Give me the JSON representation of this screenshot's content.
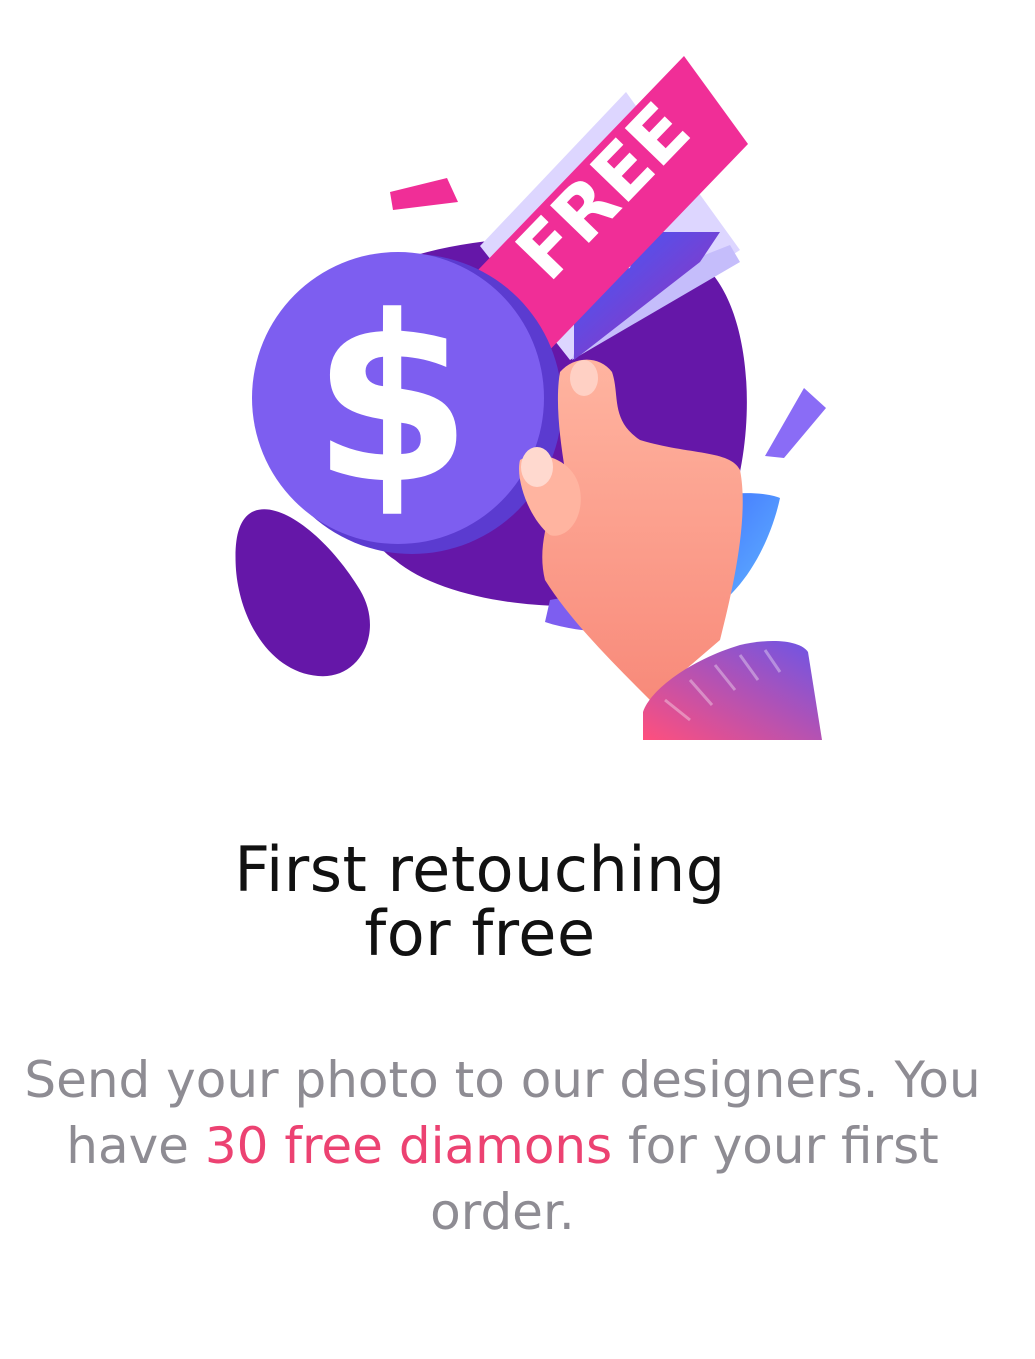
{
  "illustration": {
    "badge_text": "FREE",
    "coin_symbol": "$",
    "colors": {
      "blob": "#6517a8",
      "coin": "#7d5ef0",
      "coin_light": "#8a6cf6",
      "badge": "#f02e97",
      "paper": "#d9d3ff",
      "skin": "#f99a86",
      "sleeve": "#7b55d8"
    }
  },
  "content": {
    "title_line1": "First retouching",
    "title_line2": "for free",
    "desc_part1": "Send your photo to our designers. You have ",
    "desc_highlight": "30 free diamons",
    "desc_part2": " for your first order."
  },
  "colors": {
    "title": "#111111",
    "body": "#8e8c93",
    "highlight": "#ec4272"
  }
}
